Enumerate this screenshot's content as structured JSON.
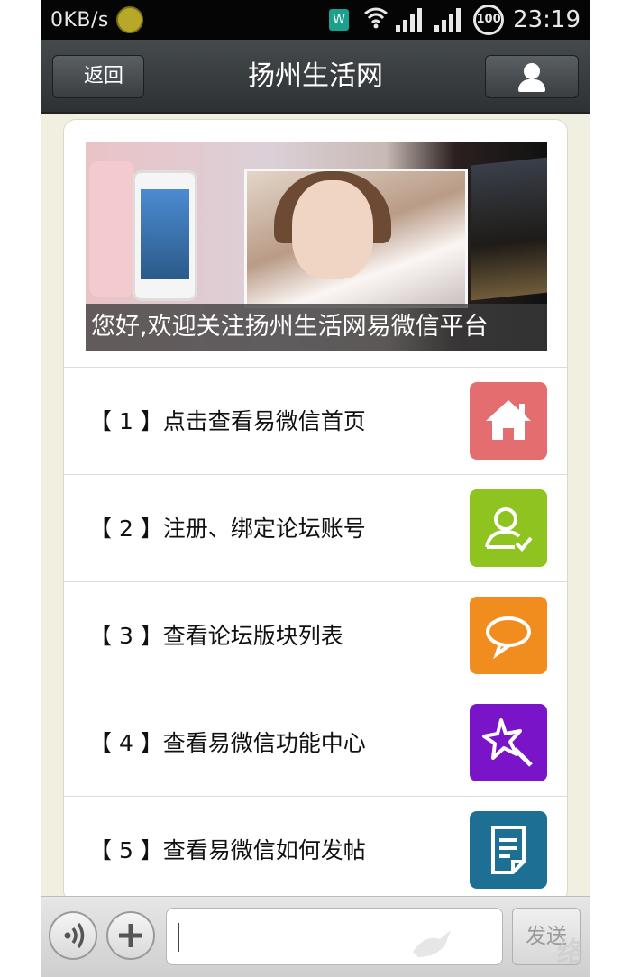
{
  "status_bar": {
    "network_speed": "0KB/s",
    "app_badge": "W",
    "battery": "100",
    "time": "23:19"
  },
  "header": {
    "back_label": "返回",
    "title": "扬州生活网"
  },
  "banner": {
    "caption": "您好,欢迎关注扬州生活网易微信平台"
  },
  "menu": {
    "items": [
      {
        "label": "【 1 】点击查看易微信首页",
        "icon": "home-icon",
        "color": "#e46d70"
      },
      {
        "label": "【 2 】注册、绑定论坛账号",
        "icon": "user-check-icon",
        "color": "#8fc31f"
      },
      {
        "label": "【 3 】查看论坛版块列表",
        "icon": "chat-bubble-icon",
        "color": "#f18d1e"
      },
      {
        "label": "【 4 】查看易微信功能中心",
        "icon": "magic-wand-icon",
        "color": "#7a14c8"
      },
      {
        "label": "【 5 】查看易微信如何发帖",
        "icon": "document-icon",
        "color": "#1d6f94"
      }
    ]
  },
  "input_bar": {
    "send_label": "发送",
    "input_value": ""
  },
  "watermark": "络"
}
